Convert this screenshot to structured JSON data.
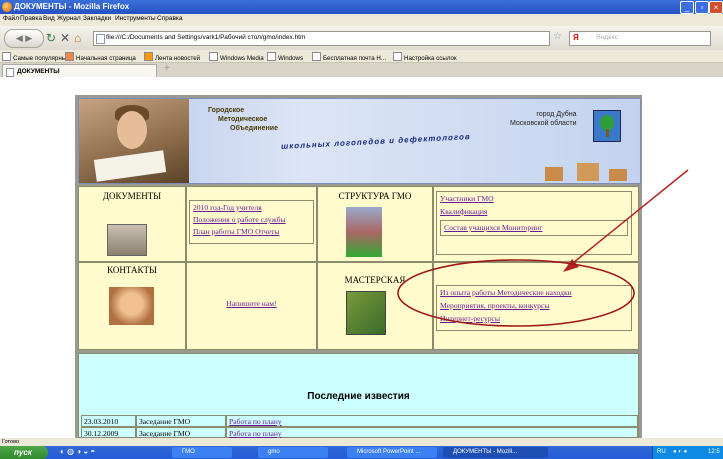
{
  "window": {
    "title": "ДОКУМЕНТЫ - Mozilla Firefox"
  },
  "menu": [
    "Файл",
    "Правка",
    "Вид",
    "Журнал",
    "Закладки",
    "Инструменты",
    "Справка"
  ],
  "nav": {
    "url": "file:///C:/Documents and Settings/vark1/Рабочий стол/gmo/index.htm",
    "search_placeholder": "Яндекс",
    "search_brand": "Я"
  },
  "bookmarks": [
    "Самые популярные",
    "Начальная страница",
    "Лента новостей",
    "Windows Media",
    "Windows",
    "Бесплатная почта Н...",
    "Настройка ссылок"
  ],
  "tab": {
    "label": "ДОКУМЕНТЫ",
    "new_tab": "+"
  },
  "banner": {
    "org_line1": "Городское",
    "org_line2": "Методическое",
    "org_line3": "Объединение",
    "org_subtitle": "школьных логопедов и дефектологов",
    "city_line1": "город Дубна",
    "city_line2": "Московской области"
  },
  "sections": {
    "documents": {
      "title": "ДОКУМЕНТЫ",
      "links": [
        "2010 год-Год учителя",
        "Положения о работе службы",
        "План работы ГМО Отчеты"
      ]
    },
    "structure": {
      "title": "СТРУКТУРА ГМО",
      "links": [
        "Участники ГМО",
        "Квалификация",
        "Состав учащихся  Мониторинг"
      ]
    },
    "contacts": {
      "title": "КОНТАКТЫ",
      "write_link": "Напишите нам!"
    },
    "workshop": {
      "title": "МАСТЕРСКАЯ",
      "links": [
        "Из опыта работы Методические находки",
        "Мероприятия, проекты, конкурсы",
        "Интернет-ресурсы"
      ]
    }
  },
  "news": {
    "title": "Последние известия",
    "rows": [
      {
        "date": "23.03.2010",
        "event": "Заседание ГМО",
        "link": "Работа по плану"
      },
      {
        "date": "30.12.2009",
        "event": "Заседание ГМО",
        "link": "Работа по плану"
      }
    ]
  },
  "status_text": "Готово",
  "taskbar": {
    "start": "пуск",
    "items": [
      "ГМО",
      "gmo",
      "Microsoft PowerPoint ...",
      "ДОКУМЕНТЫ - Mozill..."
    ],
    "tray_lang": "RU",
    "clock": "12:5"
  },
  "colors": {
    "cell_bg": "#fffbcc",
    "news_bg": "#ccffff",
    "link": "#6b1a9a",
    "annotation": "#b22222",
    "titlebar": "#2552c4"
  }
}
